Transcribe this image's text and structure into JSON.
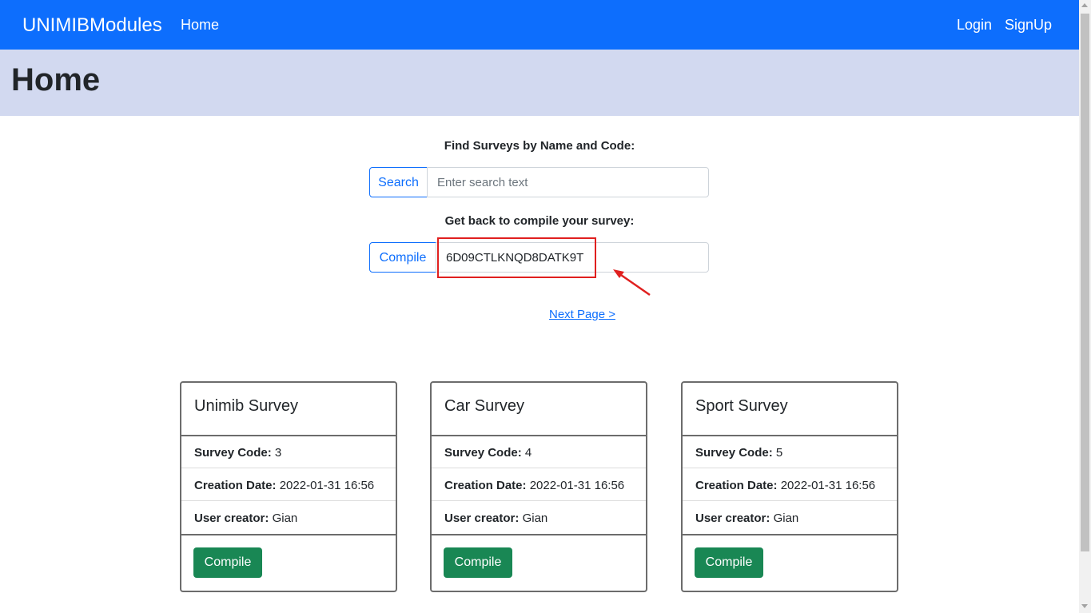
{
  "navbar": {
    "brand": "UNIMIBModules",
    "home": "Home",
    "login": "Login",
    "signup": "SignUp",
    "color": "#0d6efd"
  },
  "header": {
    "title": "Home"
  },
  "search": {
    "label": "Find Surveys by Name and Code:",
    "button": "Search",
    "placeholder": "Enter search text",
    "value": ""
  },
  "compile": {
    "label": "Get back to compile your survey:",
    "button": "Compile",
    "value": "6D09CTLKNQD8DATK9T"
  },
  "next_page": "Next Page >",
  "cards": [
    {
      "title": "Unimib Survey",
      "code_label": "Survey Code:",
      "code": "3",
      "date_label": "Creation Date:",
      "date": "2022-01-31 16:56",
      "user_label": "User creator:",
      "user": "Gian",
      "button": "Compile"
    },
    {
      "title": "Car Survey",
      "code_label": "Survey Code:",
      "code": "4",
      "date_label": "Creation Date:",
      "date": "2022-01-31 16:56",
      "user_label": "User creator:",
      "user": "Gian",
      "button": "Compile"
    },
    {
      "title": "Sport Survey",
      "code_label": "Survey Code:",
      "code": "5",
      "date_label": "Creation Date:",
      "date": "2022-01-31 16:56",
      "user_label": "User creator:",
      "user": "Gian",
      "button": "Compile"
    }
  ],
  "colors": {
    "primary": "#0d6efd",
    "success": "#198754",
    "header_bg": "#d2d9f0",
    "annotation": "#e0201f"
  }
}
